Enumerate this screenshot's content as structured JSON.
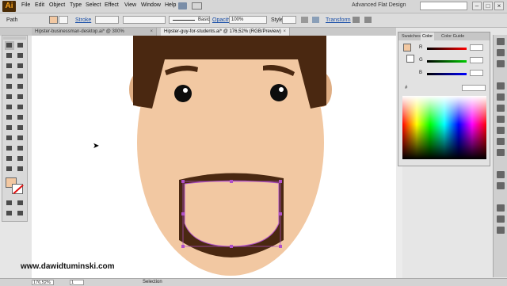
{
  "menubar": {
    "logo": "Ai",
    "items": [
      "File",
      "Edit",
      "Object",
      "Type",
      "Select",
      "Effect",
      "View",
      "Window",
      "Help"
    ],
    "workspace": "Advanced Flat Design",
    "window_controls": [
      "–",
      "□",
      "×"
    ]
  },
  "controlbar": {
    "selection_type": "Path",
    "stroke_label": "Stroke",
    "brush_name": "Basic",
    "opacity_label": "Opacity",
    "opacity_value": "100%",
    "style_label": "Style",
    "transform_label": "Transform"
  },
  "tabs": [
    {
      "label": "Hipster-businessman-desktop.ai* @ 300% (RGB/Preview)",
      "close": "×"
    },
    {
      "label": "Hipster-guy-for-students.ai* @ 176,52% (RGB/Preview)",
      "close": "×"
    }
  ],
  "color_panel": {
    "tabs": [
      "Swatches",
      "Color",
      "Color Guide"
    ],
    "sliders": [
      "R",
      "G",
      "B"
    ],
    "hex_prefix": "#"
  },
  "canvas": {
    "watermark": "www.dawidtuminski.com"
  },
  "statusbar": {
    "zoom": "176,52%",
    "page": "1",
    "status": "Selection"
  },
  "colors": {
    "skin": "#f2c8a2",
    "hair": "#4a2811",
    "eye": "#0d0d0d",
    "mouth": "#f2c8a2",
    "selection": "#b050c8"
  }
}
